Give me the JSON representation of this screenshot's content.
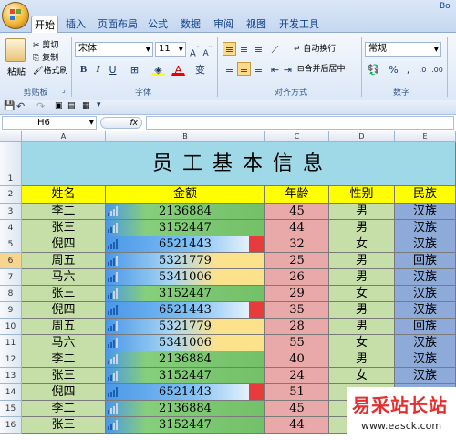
{
  "ribbon": {
    "tabs": [
      "开始",
      "插入",
      "页面布局",
      "公式",
      "数据",
      "审阅",
      "视图",
      "开发工具"
    ],
    "active_tab": "开始",
    "clipboard": {
      "paste": "粘贴",
      "cut": "剪切",
      "copy": "复制",
      "format_painter": "格式刷",
      "group": "剪贴板"
    },
    "font": {
      "name": "宋体",
      "size": "11",
      "group": "字体"
    },
    "alignment": {
      "wrap": "自动换行",
      "merge": "合并后居中",
      "group": "对齐方式"
    },
    "number": {
      "format": "常规",
      "group": "数字"
    },
    "edge": "Bo"
  },
  "formula_bar": {
    "name_box": "H6",
    "fx": "fx",
    "content": ""
  },
  "columns": [
    "A",
    "B",
    "C",
    "D",
    "E"
  ],
  "title": "员 工 基 本 信 息",
  "headers": [
    "姓名",
    "金额",
    "年龄",
    "性别",
    "民族"
  ],
  "rows": [
    {
      "name": "李二",
      "amount": "2136884",
      "age": "45",
      "gender": "男",
      "ethnic": "汉族"
    },
    {
      "name": "张三",
      "amount": "3152447",
      "age": "44",
      "gender": "男",
      "ethnic": "汉族"
    },
    {
      "name": "倪四",
      "amount": "6521443",
      "age": "32",
      "gender": "女",
      "ethnic": "汉族"
    },
    {
      "name": "周五",
      "amount": "5321779",
      "age": "25",
      "gender": "男",
      "ethnic": "回族"
    },
    {
      "name": "马六",
      "amount": "5341006",
      "age": "26",
      "gender": "男",
      "ethnic": "汉族"
    },
    {
      "name": "张三",
      "amount": "3152447",
      "age": "29",
      "gender": "女",
      "ethnic": "汉族"
    },
    {
      "name": "倪四",
      "amount": "6521443",
      "age": "35",
      "gender": "男",
      "ethnic": "汉族"
    },
    {
      "name": "周五",
      "amount": "5321779",
      "age": "28",
      "gender": "男",
      "ethnic": "回族"
    },
    {
      "name": "马六",
      "amount": "5341006",
      "age": "55",
      "gender": "女",
      "ethnic": "汉族"
    },
    {
      "name": "李二",
      "amount": "2136884",
      "age": "40",
      "gender": "男",
      "ethnic": "汉族"
    },
    {
      "name": "张三",
      "amount": "3152447",
      "age": "24",
      "gender": "女",
      "ethnic": "汉族"
    },
    {
      "name": "倪四",
      "amount": "6521443",
      "age": "51",
      "gender": "",
      "ethnic": ""
    },
    {
      "name": "李二",
      "amount": "2136884",
      "age": "45",
      "gender": "",
      "ethnic": ""
    },
    {
      "name": "张三",
      "amount": "3152447",
      "age": "44",
      "gender": "",
      "ethnic": ""
    }
  ],
  "row_numbers": [
    "1",
    "2",
    "3",
    "4",
    "5",
    "6",
    "7",
    "8",
    "9",
    "10",
    "11",
    "12",
    "13",
    "14",
    "15",
    "16"
  ],
  "selected_row": "6",
  "watermark": {
    "text": "易采站长站",
    "url": "www.easck.com"
  },
  "colors": {
    "title_bg": "#9fd9e8",
    "header_bg": "#ffff00",
    "name_bg": "#c6dfa9",
    "age_bg": "#e9a9a9",
    "gender_bg": "#c6dfa9",
    "ethnic_bg": "#8eaad8",
    "hi": "#e83b3b"
  }
}
